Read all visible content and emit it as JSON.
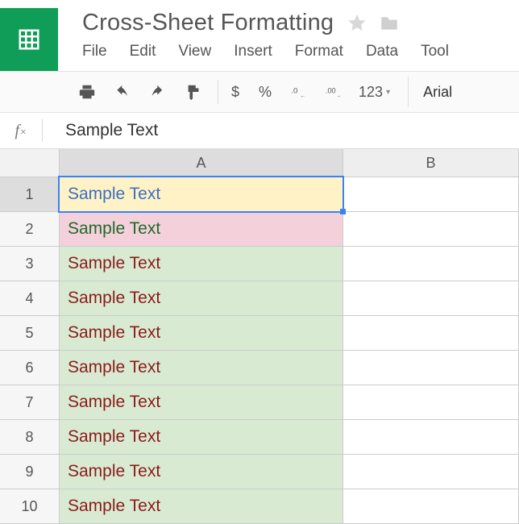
{
  "doc": {
    "title": "Cross-Sheet Formatting"
  },
  "menu": {
    "file": "File",
    "edit": "Edit",
    "view": "View",
    "insert": "Insert",
    "format": "Format",
    "data": "Data",
    "tools": "Tool"
  },
  "toolbar": {
    "currency": "$",
    "percent": "%",
    "decDec": ".0",
    "incDec": ".00",
    "numfmt": "123",
    "font": "Arial"
  },
  "formula_bar": {
    "fx": "f",
    "fx_sub": "×",
    "content": "Sample Text"
  },
  "columns": {
    "A": "A",
    "B": "B"
  },
  "rows": [
    {
      "n": "1",
      "A": "Sample Text",
      "bg": "#fff2c7",
      "fg": "#3b6fbf",
      "selected": true
    },
    {
      "n": "2",
      "A": "Sample Text",
      "bg": "#f3d0da",
      "fg": "#1f6b2a"
    },
    {
      "n": "3",
      "A": "Sample Text",
      "bg": "#d9ead3",
      "fg": "#8a1b1b"
    },
    {
      "n": "4",
      "A": "Sample Text",
      "bg": "#d9ead3",
      "fg": "#8a1b1b"
    },
    {
      "n": "5",
      "A": "Sample Text",
      "bg": "#d9ead3",
      "fg": "#8a1b1b"
    },
    {
      "n": "6",
      "A": "Sample Text",
      "bg": "#d9ead3",
      "fg": "#8a1b1b"
    },
    {
      "n": "7",
      "A": "Sample Text",
      "bg": "#d9ead3",
      "fg": "#8a1b1b"
    },
    {
      "n": "8",
      "A": "Sample Text",
      "bg": "#d9ead3",
      "fg": "#8a1b1b"
    },
    {
      "n": "9",
      "A": "Sample Text",
      "bg": "#d9ead3",
      "fg": "#8a1b1b"
    },
    {
      "n": "10",
      "A": "Sample Text",
      "bg": "#d9ead3",
      "fg": "#8a1b1b"
    }
  ]
}
